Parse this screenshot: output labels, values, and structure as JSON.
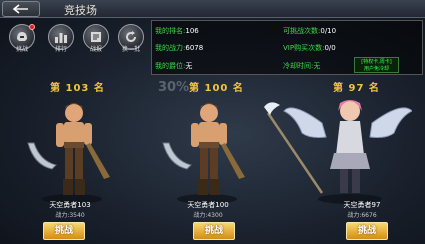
{
  "header": {
    "title": "竞技场"
  },
  "menu": [
    {
      "label": "挑战",
      "icon": "helmet-icon",
      "badge": "!"
    },
    {
      "label": "排行",
      "icon": "ranking-icon"
    },
    {
      "label": "战报",
      "icon": "report-icon"
    },
    {
      "label": "换一批",
      "icon": "refresh-icon"
    }
  ],
  "info": {
    "rank_label": "我的排名:",
    "rank_value": "106",
    "power_label": "我的战力:",
    "power_value": "6078",
    "title_label": "我的爵位:",
    "title_value": "无",
    "challenges_label": "可挑战次数:",
    "challenges_value": "0/10",
    "vip_label": "VIP购买次数:",
    "vip_value": "0/0",
    "cooldown_label": "冷却时间:",
    "cooldown_value": "无",
    "vip_btn_line1": "[特权卡,周卡]",
    "vip_btn_line2": "用户免冷却"
  },
  "overlay_text": "30%",
  "competitors": [
    {
      "rank": "第 103 名",
      "name": "天空勇者103",
      "power": "战力:3540",
      "button": "挑战"
    },
    {
      "rank": "第 100 名",
      "name": "天空勇者100",
      "power": "战力:4300",
      "button": "挑战"
    },
    {
      "rank": "第 97 名",
      "name": "天空勇者97",
      "power": "战力:6676",
      "button": "挑战"
    }
  ],
  "colors": {
    "accent_green": "#3ed94a",
    "rank_gold": "#f4c542",
    "button_gold": "#e0a020"
  }
}
